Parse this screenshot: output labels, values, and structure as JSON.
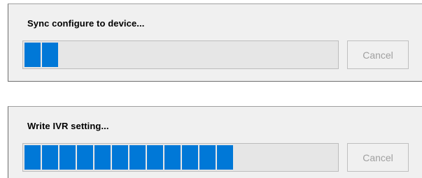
{
  "dialogs": [
    {
      "message": "Sync configure to device...",
      "progress_blocks": 2,
      "cancel_label": "Cancel",
      "cancel_enabled": false
    },
    {
      "message": "Write IVR setting...",
      "progress_blocks": 12,
      "cancel_label": "Cancel",
      "cancel_enabled": false
    }
  ],
  "colors": {
    "progress_block": "#0078d7",
    "dialog_background": "#f0f0f0",
    "disabled_text": "#a0a0a0"
  }
}
